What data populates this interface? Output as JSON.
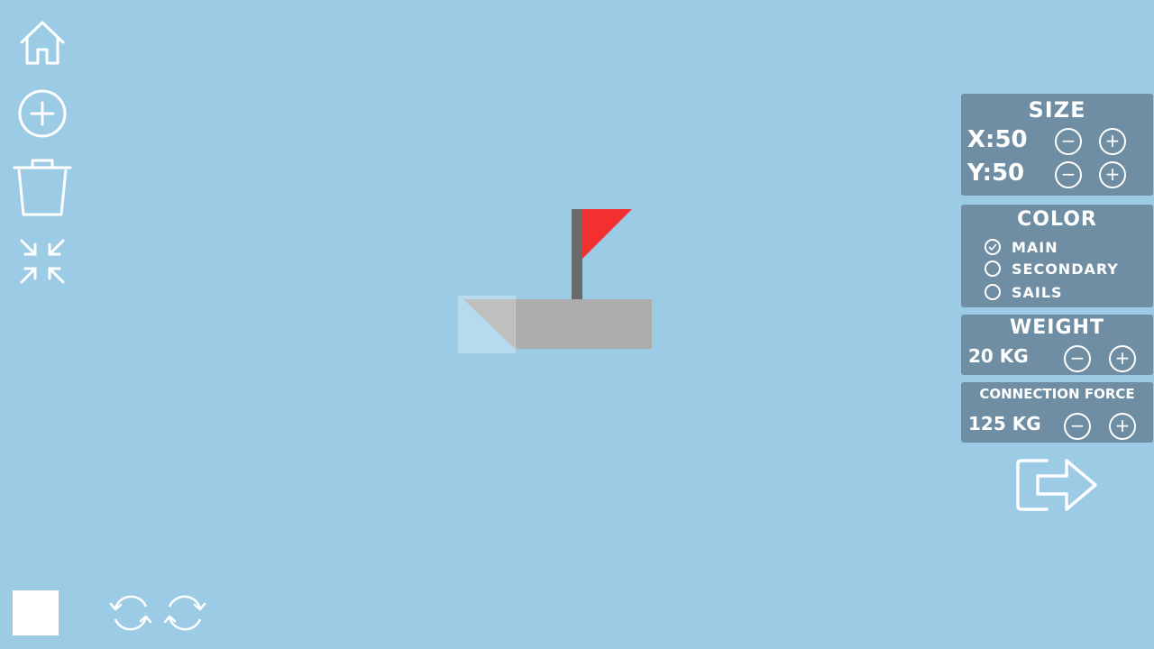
{
  "toolbar": {
    "home_icon": "home-icon",
    "add_icon": "add-circle-icon",
    "delete_icon": "trash-icon",
    "collapse_icon": "collapse-arrows-icon"
  },
  "size_panel": {
    "title": "SIZE",
    "x_label": "X:50",
    "y_label": "Y:50",
    "minus": "−",
    "plus": "+"
  },
  "color_panel": {
    "title": "COLOR",
    "options": [
      {
        "label": "MAIN",
        "selected": true
      },
      {
        "label": "SECONDARY",
        "selected": false
      },
      {
        "label": "SAILS",
        "selected": false
      }
    ]
  },
  "weight_panel": {
    "title": "WEIGHT",
    "value": "20 KG",
    "minus": "−",
    "plus": "+"
  },
  "force_panel": {
    "title": "CONNECTION FORCE",
    "value": "125 KG",
    "minus": "−",
    "plus": "+"
  },
  "colors": {
    "background": "#9ccbe6",
    "panel": "#6f8ea3",
    "hull": "#adadad",
    "flag": "#f23030",
    "mast": "#6a6a6a"
  },
  "bottom": {
    "color_swatch": "#ffffff",
    "rotate_left_icon": "rotate-left-icon",
    "rotate_right_icon": "rotate-right-icon"
  },
  "exit_icon": "exit-arrow-icon"
}
